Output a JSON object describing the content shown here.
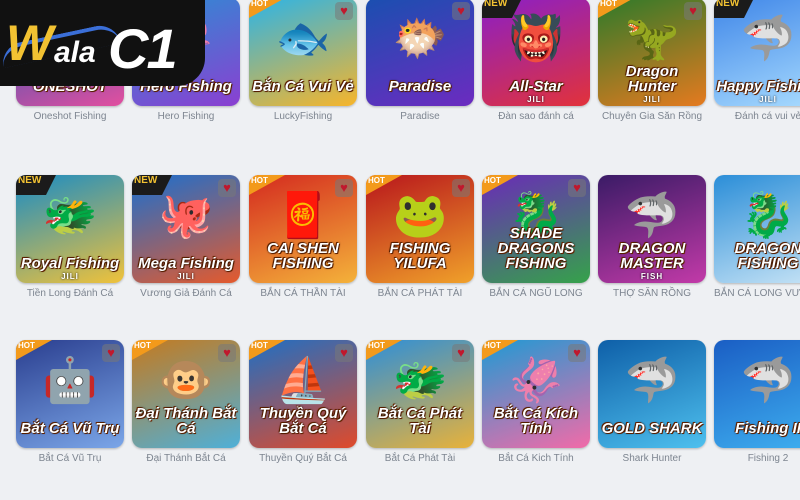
{
  "logo": {
    "part1": "W",
    "part2": "ala",
    "part3": "C1"
  },
  "rows": [
    [
      {
        "label": "Oneshot Fishing",
        "title": "ONESHOT",
        "brand": "",
        "badge": "",
        "fav": false,
        "bg": "#1b56b8",
        "bg2": "#e34f9f",
        "art": "🐙"
      },
      {
        "label": "Hero Fishing",
        "title": "Hero Fishing",
        "brand": "",
        "badge": "",
        "fav": false,
        "bg": "#2a8fd4",
        "bg2": "#8b3fd1",
        "art": "🦑"
      },
      {
        "label": "LuckyFishing",
        "title": "Bắn Cá Vui Vẻ",
        "brand": "",
        "badge": "HOT",
        "fav": true,
        "bg": "#2bb4e8",
        "bg2": "#f7b52a",
        "art": "🐟"
      },
      {
        "label": "Paradise",
        "title": "Paradise",
        "brand": "",
        "badge": "",
        "fav": true,
        "bg": "#1a4fb0",
        "bg2": "#6c2bc0",
        "art": "🐡"
      },
      {
        "label": "Đàn sao đánh cá",
        "title": "All-Star",
        "brand": "JILI",
        "badge": "NEW",
        "fav": false,
        "bg": "#8a1fc7",
        "bg2": "#e2323a",
        "art": "👹"
      },
      {
        "label": "Chuyên Gia Săn Rồng",
        "title": "Dragon Hunter",
        "brand": "JILI",
        "badge": "HOT",
        "fav": true,
        "bg": "#2d7a2a",
        "bg2": "#e57a1f",
        "art": "🦖"
      },
      {
        "label": "Đánh cá vui vẻ",
        "title": "Happy Fishing",
        "brand": "JILI",
        "badge": "NEW",
        "fav": false,
        "bg": "#3f86e8",
        "bg2": "#a9dcff",
        "art": "🦈"
      }
    ],
    [
      {
        "label": "Tiền Long Đánh Cá",
        "title": "Royal Fishing",
        "brand": "JILI",
        "badge": "NEW",
        "fav": false,
        "bg": "#1a8cc4",
        "bg2": "#f0c23a",
        "art": "🐲"
      },
      {
        "label": "Vương Giả Đánh Cá",
        "title": "Mega Fishing",
        "brand": "JILI",
        "badge": "NEW",
        "fav": true,
        "bg": "#1b6fcf",
        "bg2": "#e55a2c",
        "art": "🐙"
      },
      {
        "label": "BẮN CÁ THẦN TÀI",
        "title": "CAI SHEN FISHING",
        "brand": "",
        "badge": "HOT",
        "fav": true,
        "bg": "#d42a1f",
        "bg2": "#f4b23a",
        "art": "🧧"
      },
      {
        "label": "BẮN CÁ PHÁT TÀI",
        "title": "FISHING YILUFA",
        "brand": "",
        "badge": "HOT",
        "fav": true,
        "bg": "#b8161c",
        "bg2": "#f0a12a",
        "art": "🐸"
      },
      {
        "label": "BẮN CÁ NGŨ LONG",
        "title": "SHADE DRAGONS FISHING",
        "brand": "",
        "badge": "HOT",
        "fav": true,
        "bg": "#6a2bb8",
        "bg2": "#35a24a",
        "art": "🐉"
      },
      {
        "label": "THỢ SĂN RỒNG",
        "title": "DRAGON MASTER",
        "brand": "FISH",
        "badge": "",
        "fav": false,
        "bg": "#3a1b66",
        "bg2": "#c23aa8",
        "art": "🦈"
      },
      {
        "label": "BẮN CÁ LONG VƯƠNG",
        "title": "DRAGON FISHING",
        "brand": "",
        "badge": "",
        "fav": false,
        "bg": "#2b8ed8",
        "bg2": "#c8e4f6",
        "art": "🐉"
      }
    ],
    [
      {
        "label": "Bắt Cá Vũ Trụ",
        "title": "Bắt Cá Vũ Trụ",
        "brand": "",
        "badge": "HOT",
        "fav": true,
        "bg": "#2a3e8f",
        "bg2": "#7ba6e8",
        "art": "🤖"
      },
      {
        "label": "Đại Thánh Bắt Cá",
        "title": "Đại Thánh Bắt Cá",
        "brand": "",
        "badge": "HOT",
        "fav": true,
        "bg": "#c47a1f",
        "bg2": "#4fb0d8",
        "art": "🐵"
      },
      {
        "label": "Thuyền Quý Bắt Cá",
        "title": "Thuyền Quý Bắt Cá",
        "brand": "",
        "badge": "HOT",
        "fav": true,
        "bg": "#1f6fc4",
        "bg2": "#e04a2a",
        "art": "⛵"
      },
      {
        "label": "Bắt Cá Phát Tài",
        "title": "Bắt Cá Phát Tài",
        "brand": "",
        "badge": "HOT",
        "fav": true,
        "bg": "#2e8fd8",
        "bg2": "#e8b23a",
        "art": "🐲"
      },
      {
        "label": "Bắt Cá Kich Tính",
        "title": "Bắt Cá Kích Tính",
        "brand": "",
        "badge": "HOT",
        "fav": true,
        "bg": "#1f9ad4",
        "bg2": "#f26ba8",
        "art": "🦑"
      },
      {
        "label": "Shark Hunter",
        "title": "GOLD SHARK",
        "brand": "",
        "badge": "",
        "fav": false,
        "bg": "#0e5fa8",
        "bg2": "#4ec0ee",
        "art": "🦈"
      },
      {
        "label": "Fishing 2",
        "title": "Fishing II",
        "brand": "",
        "badge": "",
        "fav": false,
        "bg": "#1a5ec4",
        "bg2": "#3fb0f0",
        "art": "🦈"
      }
    ]
  ],
  "heart": "♥"
}
